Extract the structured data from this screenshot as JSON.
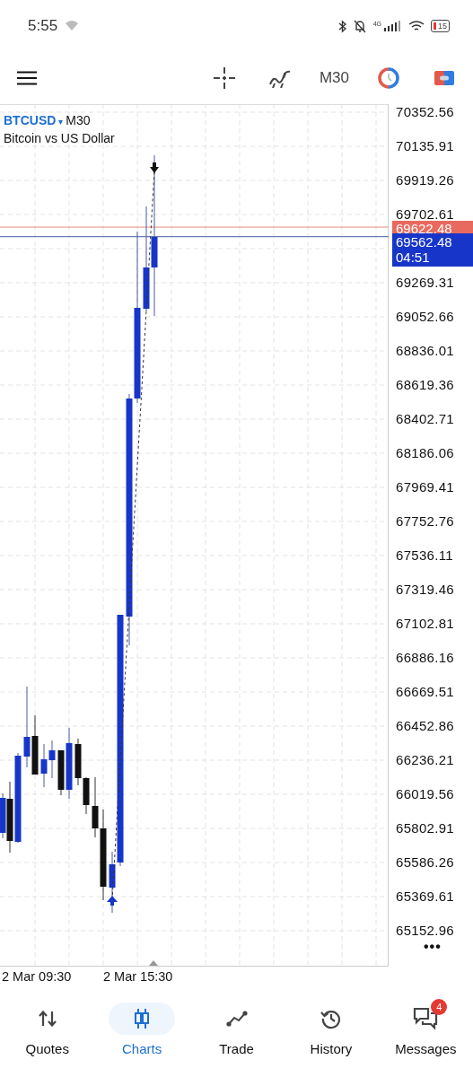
{
  "status_bar": {
    "time": "5:55",
    "network": "4G",
    "battery": "15"
  },
  "toolbar": {
    "timeframe": "M30"
  },
  "chart": {
    "symbol": "BTCUSD",
    "caret": "▾",
    "timeframe": "M30",
    "description": "Bitcoin vs US Dollar",
    "price_labels": [
      "70352.56",
      "70135.91",
      "69919.26",
      "69702.61",
      "69269.31",
      "69052.66",
      "68836.01",
      "68619.36",
      "68402.71",
      "68186.06",
      "67969.41",
      "67752.76",
      "67536.11",
      "67319.46",
      "67102.81",
      "66886.16",
      "66669.51",
      "66452.86",
      "66236.21",
      "66019.56",
      "65802.91",
      "65586.26",
      "65369.61",
      "65152.96"
    ],
    "ask_price": "69622.48",
    "bid_price": "69562.48",
    "countdown": "04:51",
    "more": "•••",
    "time_labels": [
      "2 Mar 09:30",
      "2 Mar 15:30"
    ]
  },
  "nav": [
    {
      "kind": "quotes",
      "label": "Quotes",
      "selected": false
    },
    {
      "kind": "charts",
      "label": "Charts",
      "selected": true
    },
    {
      "kind": "trade",
      "label": "Trade",
      "selected": false
    },
    {
      "kind": "history",
      "label": "History",
      "selected": false
    },
    {
      "kind": "messages",
      "label": "Messages",
      "selected": false,
      "badge": "4"
    }
  ]
}
